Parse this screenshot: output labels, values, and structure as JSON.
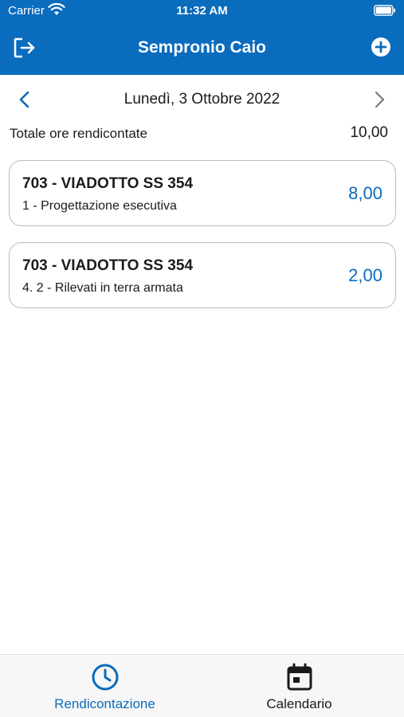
{
  "status_bar": {
    "carrier": "Carrier",
    "time": "11:32 AM",
    "wifi_icon": "wifi-icon",
    "battery_icon": "battery-icon"
  },
  "header": {
    "title": "Sempronio Caio",
    "logout_icon": "logout-icon",
    "add_icon": "plus-circle-icon",
    "background_color": "#0a6cbd"
  },
  "date_nav": {
    "date": "Lunedì, 3 Ottobre 2022",
    "prev_icon": "chevron-left-icon",
    "next_icon": "chevron-right-icon"
  },
  "summary": {
    "label": "Totale ore rendicontate",
    "value": "10,00"
  },
  "entries": [
    {
      "project": "703 - VIADOTTO SS 354",
      "task": "1 - Progettazione esecutiva",
      "hours": "8,00"
    },
    {
      "project": "703 - VIADOTTO SS 354",
      "task": "4. 2 - Rilevati in terra armata",
      "hours": "2,00"
    }
  ],
  "tabbar": {
    "tabs": [
      {
        "label": "Rendicontazione",
        "icon": "clock-icon",
        "active": true
      },
      {
        "label": "Calendario",
        "icon": "calendar-icon",
        "active": false
      }
    ]
  },
  "colors": {
    "accent": "#0a6cbd",
    "text": "#1a1a1a",
    "card_border": "#bdbdbd",
    "tabbar_bg": "#f7f7f7"
  }
}
